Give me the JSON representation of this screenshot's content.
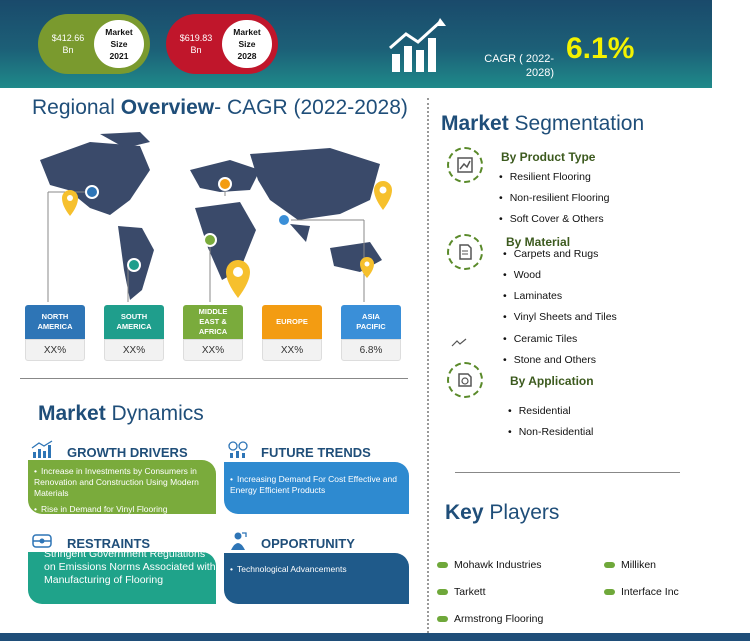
{
  "header": {
    "market_2021": {
      "value": "$412.66",
      "unit": "Bn",
      "label_line1": "Market",
      "label_line2": "Size",
      "year": "2021"
    },
    "market_2028": {
      "value": "$619.83",
      "unit": "Bn",
      "label_line1": "Market",
      "label_line2": "Size",
      "year": "2028"
    },
    "cagr_label_line1": "CAGR ( 2022-",
    "cagr_label_line2": "2028)",
    "cagr_value": "6.1%"
  },
  "regional": {
    "title_pre": "Regional",
    "title_bold": "Overview",
    "title_post": "- CAGR (2022-2028)",
    "regions": [
      {
        "name_line1": "NORTH",
        "name_line2": "AMERICA",
        "name_line3": "",
        "value": "XX%",
        "color": "#2e75b6"
      },
      {
        "name_line1": "SOUTH",
        "name_line2": "AMERICA",
        "name_line3": "",
        "value": "XX%",
        "color": "#1f9e8c"
      },
      {
        "name_line1": "MIDDLE",
        "name_line2": "EAST &",
        "name_line3": "AFRICA",
        "value": "XX%",
        "color": "#7aab3c"
      },
      {
        "name_line1": "EUROPE",
        "name_line2": "",
        "name_line3": "",
        "value": "XX%",
        "color": "#f39c12"
      },
      {
        "name_line1": "ASIA",
        "name_line2": "PACIFIC",
        "name_line3": "",
        "value": "6.8%",
        "color": "#3a8fd8"
      }
    ]
  },
  "segmentation": {
    "title_bold": "Market",
    "title_rest": "Segmentation",
    "product_type": {
      "heading": "By Product Type",
      "items": [
        "Resilient Flooring",
        "Non-resilient Flooring",
        "Soft Cover & Others"
      ]
    },
    "material": {
      "heading": "By Material",
      "items": [
        "Carpets and Rugs",
        "Wood",
        "Laminates",
        "Vinyl Sheets and Tiles",
        "Ceramic Tiles",
        "Stone and Others"
      ]
    },
    "application": {
      "heading": "By Application",
      "items": [
        "Residential",
        "Non-Residential"
      ]
    }
  },
  "dynamics": {
    "title_bold": "Market",
    "title_rest": "Dynamics",
    "growth_drivers": {
      "title": "GROWTH DRIVERS",
      "items": [
        "Increase in Investments by Consumers in Renovation and Construction Using Modern Materials",
        "Rise in Demand for Vinyl Flooring"
      ]
    },
    "future_trends": {
      "title": "FUTURE TRENDS",
      "items": [
        "Increasing Demand For Cost Effective and Energy Efficient Products"
      ]
    },
    "restraints": {
      "title": "RESTRAINTS",
      "text": "Stringent Government Regulations on Emissions Norms Associated with Manufacturing of Flooring"
    },
    "opportunity": {
      "title": "OPPORTUNITY",
      "items": [
        "Technological Advancements"
      ]
    }
  },
  "key_players": {
    "title_bold": "Key",
    "title_rest": "Players",
    "players": [
      "Mohawk Industries",
      "Milliken",
      "Tarkett",
      "Interface Inc",
      "Armstrong Flooring"
    ]
  },
  "colors": {
    "header_dark": "#1a4a6b",
    "pill_green": "#7a9a2e",
    "pill_red": "#c0162b",
    "cagr_yellow": "#f3f200",
    "card_green": "#7aab3c",
    "card_blue": "#2e8ad0",
    "card_teal": "#1fa38a",
    "card_navy": "#1f5a8a"
  }
}
